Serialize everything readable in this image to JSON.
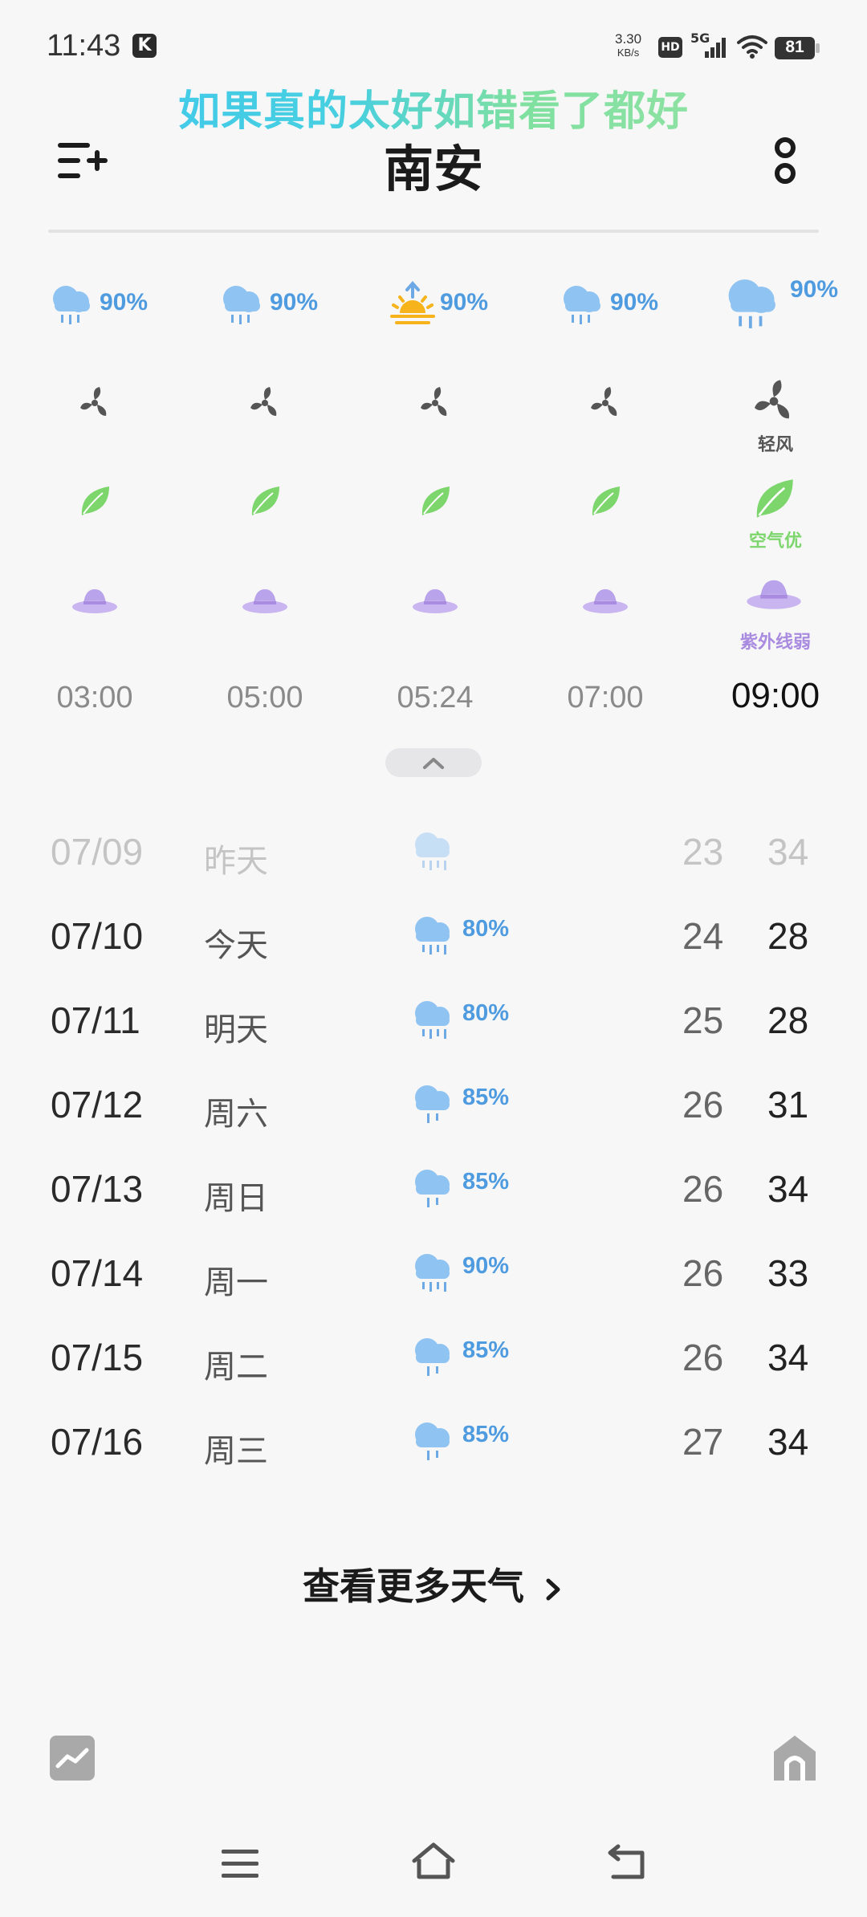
{
  "status": {
    "time": "11:43",
    "app_badge": "K",
    "net_speed": "3.30",
    "net_unit": "KB/s",
    "hd": "HD",
    "network": "5G",
    "battery": "81"
  },
  "marquee": "如果真的太好如错看了都好",
  "header": {
    "city": "南安"
  },
  "hourly": [
    {
      "time": "03:00",
      "precip": "90%",
      "icon": "rain-cloud-icon"
    },
    {
      "time": "05:00",
      "precip": "90%",
      "icon": "rain-cloud-icon"
    },
    {
      "time": "05:24",
      "precip": "90%",
      "icon": "sunrise-icon"
    },
    {
      "time": "07:00",
      "precip": "90%",
      "icon": "rain-cloud-icon"
    },
    {
      "time": "09:00",
      "precip": "90%",
      "icon": "rain-cloud-icon",
      "wind": "轻风",
      "air": "空气优",
      "uv": "紫外线弱"
    }
  ],
  "daily": [
    {
      "date": "07/09",
      "weekday": "昨天",
      "precip": "",
      "low": "23",
      "high": "34"
    },
    {
      "date": "07/10",
      "weekday": "今天",
      "precip": "80%",
      "low": "24",
      "high": "28"
    },
    {
      "date": "07/11",
      "weekday": "明天",
      "precip": "80%",
      "low": "25",
      "high": "28"
    },
    {
      "date": "07/12",
      "weekday": "周六",
      "precip": "85%",
      "low": "26",
      "high": "31"
    },
    {
      "date": "07/13",
      "weekday": "周日",
      "precip": "85%",
      "low": "26",
      "high": "34"
    },
    {
      "date": "07/14",
      "weekday": "周一",
      "precip": "90%",
      "low": "26",
      "high": "33"
    },
    {
      "date": "07/15",
      "weekday": "周二",
      "precip": "85%",
      "low": "26",
      "high": "34"
    },
    {
      "date": "07/16",
      "weekday": "周三",
      "precip": "85%",
      "low": "27",
      "high": "34"
    }
  ],
  "more_weather": "查看更多天气",
  "colors": {
    "accent_blue": "#4f9be0",
    "leaf_green": "#7cd66c",
    "uv_purple": "#a98be0",
    "sun_orange": "#f6b31b"
  }
}
